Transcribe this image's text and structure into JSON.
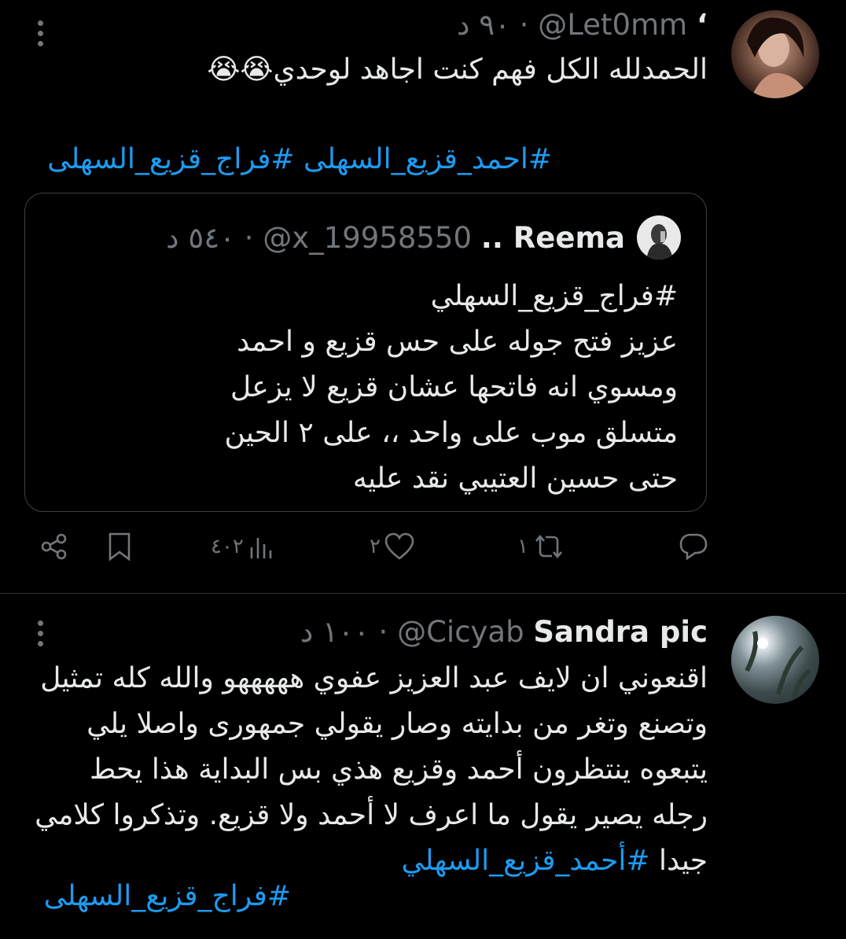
{
  "tweet1": {
    "author_name": "‘",
    "handle": "@Let0mm",
    "dot": "·",
    "time": "٩٠ د",
    "text": "الحمدلله الكل فهم كنت اجاهد لوحدي😭😭",
    "hashtags": "#احمد_قزيع_السهلى #فراج_قزيع_السهلى",
    "quote": {
      "name": "Reema ..",
      "handle": "@x_19958550",
      "dot": "·",
      "time": "٥٤٠ د",
      "lines": [
        "#فراج_قزيع_السهلي",
        "عزيز فتح جوله على حس قزيع و احمد",
        "ومسوي انه فاتحها عشان قزيع لا يزعل",
        "متسلق موب على واحد ،، على ٢ الحين",
        "حتى حسين العتيبي نقد عليه"
      ]
    },
    "actions": {
      "reply_count": "",
      "retweet_count": "١",
      "like_count": "٢",
      "views_count": "٤٠٢"
    }
  },
  "tweet2": {
    "author_name": "Sandra pic",
    "handle": "@Cicyab",
    "dot": "·",
    "time": "١٠٠ د",
    "lines": [
      "اقنعوني ان لايف عبد العزيز عفوي هههههو والله كله تمثيل",
      "وتصنع وتغر من بدايته  وصار يقولي جمهورى واصلا يلي",
      "يتبعوه ينتظرون أحمد وقزيع هذي بس البداية هذا يحط",
      "رجله يصير يقول ما اعرف لا أحمد ولا قزيع. وتذكروا كلامي"
    ],
    "last_line_text": "جيدا ",
    "last_line_hashtag": "#أحمد_قزيع_السهلي",
    "hashtag2": "#فراج_قزيع_السهلى"
  },
  "icons": [
    "more-icon",
    "reply-icon",
    "retweet-icon",
    "like-icon",
    "views-icon",
    "bookmark-icon",
    "share-icon"
  ],
  "colors": {
    "background": "#000000",
    "text": "#e7e9ea",
    "muted": "#71767b",
    "accent": "#1d9bf0",
    "border": "#2f3336"
  }
}
